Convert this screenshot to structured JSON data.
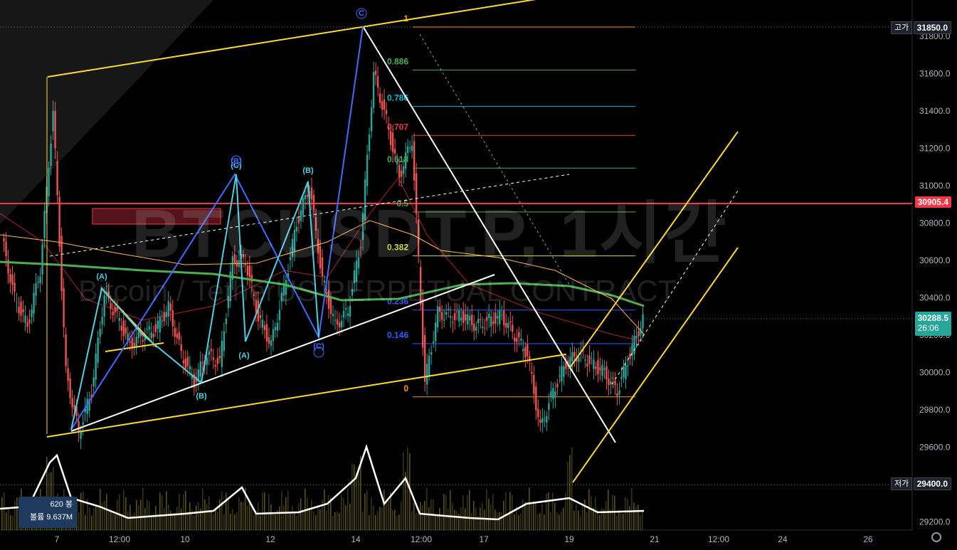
{
  "watermark": {
    "symbol": "BTCUSDT.P, 1시간",
    "description": "Bitcoin / TetherUS PERPETUAL CONTRACT"
  },
  "price_axis": {
    "ticks": [
      "31800.0",
      "31600.0",
      "31400.0",
      "31200.0",
      "31000.0",
      "30800.0",
      "30600.0",
      "30400.0",
      "30200.0",
      "30000.0",
      "29800.0",
      "29600.0",
      "29400.0",
      "29200.0"
    ],
    "high": {
      "tag": "고가",
      "value": "31850.0"
    },
    "low": {
      "tag": "저가",
      "value": "29400.0"
    },
    "level": {
      "value": "30905.4",
      "color": "#f23645"
    },
    "last": {
      "value": "30288.5",
      "countdown": "26:06",
      "color": "#26a69a"
    }
  },
  "time_axis": {
    "ticks": [
      "7",
      "12:00",
      "10",
      "12",
      "14",
      "12:00",
      "17",
      "19",
      "21",
      "12:00",
      "24",
      "26"
    ]
  },
  "volume_box": {
    "bars_label": "620 봉",
    "volume_label": "볼륨 9.637M"
  },
  "fib_levels": [
    {
      "label": "1",
      "value": 31850,
      "color": "#ff9800"
    },
    {
      "label": "0.886",
      "value": 31620,
      "color": "#4caf50"
    },
    {
      "label": "0.786",
      "value": 31425,
      "color": "#00bcd4"
    },
    {
      "label": "0.707",
      "value": 31270,
      "color": "#f23645"
    },
    {
      "label": "0.618",
      "value": 31095,
      "color": "#4caf50"
    },
    {
      "label": "0.5",
      "value": 30860,
      "color": "#4caf50"
    },
    {
      "label": "0.382",
      "value": 30625,
      "color": "#cddc39"
    },
    {
      "label": "0.236",
      "value": 30335,
      "color": "#2962ff"
    },
    {
      "label": "0.146",
      "value": 30155,
      "color": "#2962ff"
    },
    {
      "label": "0",
      "value": 29870,
      "color": "#ff9800"
    }
  ],
  "wave_labels": [
    "(A)",
    "(B)",
    "(C)",
    "(A)",
    "(B)",
    "(C)",
    "(B)",
    "C"
  ],
  "chart_data": {
    "type": "line",
    "ylim": [
      29140,
      31990
    ],
    "series": [
      {
        "values": [
          30720,
          30400,
          30250,
          30550,
          31400,
          30000,
          29680,
          29900,
          30420,
          30300,
          30150,
          30200,
          30230,
          30350,
          30100,
          29950,
          30100,
          30050,
          30600,
          30600,
          30300,
          30150,
          30450,
          30800,
          31000,
          30500,
          30250,
          30330,
          30700,
          31600,
          31350,
          31050,
          31250,
          29950,
          30320,
          30300,
          30300,
          30250,
          30280,
          30300,
          30200,
          30100,
          29700,
          29900,
          30050,
          30100,
          30050,
          30000,
          29900,
          30100,
          30290
        ]
      }
    ]
  }
}
